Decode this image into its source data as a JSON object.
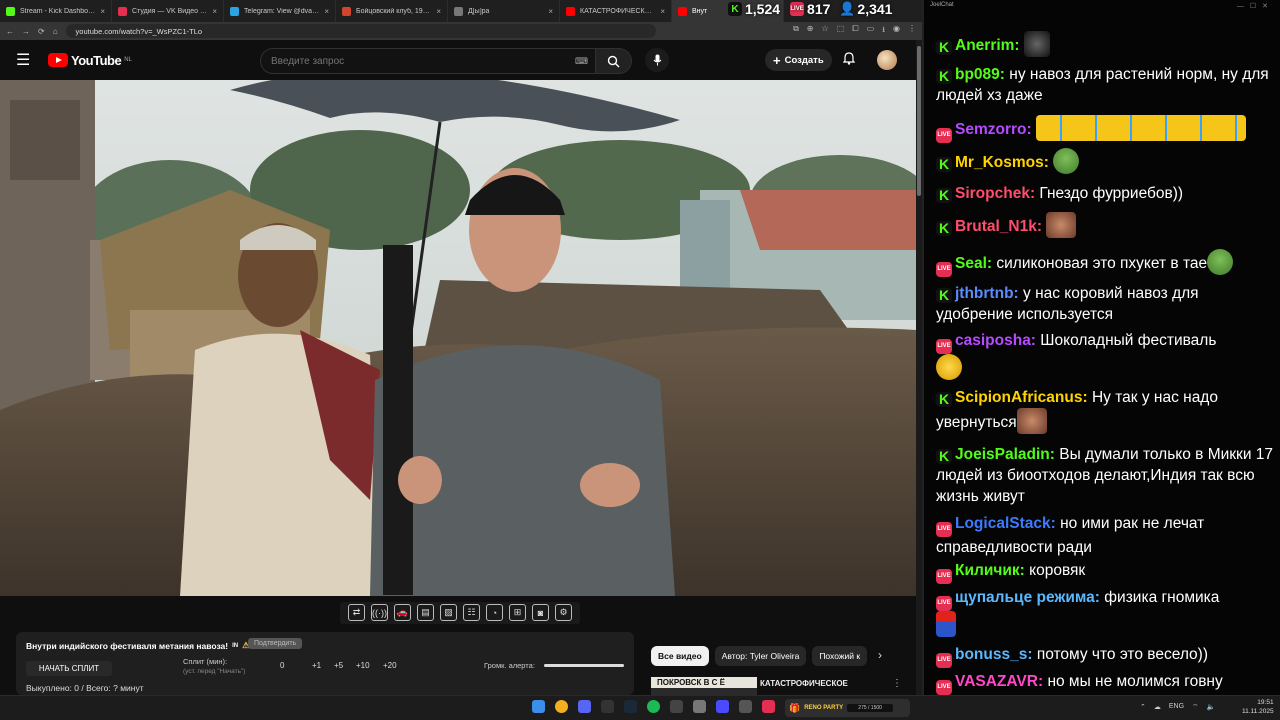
{
  "browser": {
    "tabs": [
      {
        "title": "Stream - Kick Dashboard",
        "color": "#53fc18"
      },
      {
        "title": "Студия — VK Видео Live",
        "color": "#e52f52"
      },
      {
        "title": "Telegram: View @dvachannel",
        "color": "#2aa3e0"
      },
      {
        "title": "Бойцовский клуб, 1999 — см",
        "color": "#d0452b"
      },
      {
        "title": "Д[ы]ра",
        "color": "#777777"
      },
      {
        "title": "КАТАСТРОФИЧЕСКОЕ Пора",
        "color": "#ff0000"
      },
      {
        "title": "Внут",
        "color": "#ff0000"
      }
    ],
    "url": "youtube.com/watch?v=_WsPZC1-TLo"
  },
  "overlay": {
    "kick_viewers": "1,524",
    "vk_viewers": "817",
    "total_viewers": "2,341"
  },
  "youtube": {
    "logo_text": "YouTube",
    "country_code": "NL",
    "search_placeholder": "Введите запрос",
    "create_label": "Создать"
  },
  "alert_panel": {
    "title": "Внутри индийского фестиваля метания навоза!",
    "title_suffix": "IN",
    "confirm_label": "Подтвердить",
    "start_split": "НАЧАТЬ СПЛИТ",
    "split_label": "Сплит (мин):",
    "split_hint": "(уст. перед \"Начать\")",
    "split_value": "0",
    "steps": [
      "+1",
      "+5",
      "+10",
      "+20"
    ],
    "volume_label": "Громк. алерта:",
    "volume_level": 1.0,
    "bought": "Выкуплено: 0 / Всего: ? минут"
  },
  "chips": [
    "Все видео",
    "Автор: Tyler Oliveira",
    "Похожий к"
  ],
  "recommended": {
    "thumb_text": "ПОКРОВСК В С Ё",
    "title": "КАТАСТРОФИЧЕСКОЕ"
  },
  "chat": {
    "app_title": "JoelChat",
    "messages": [
      {
        "platform": "kick",
        "nick": "Anerrim:",
        "color": "#53fc18",
        "text": "",
        "emote": "dark"
      },
      {
        "platform": "kick",
        "nick": "bp089:",
        "color": "#53fc18",
        "text": "ну навоз для растений норм, ну для людей хз даже"
      },
      {
        "platform": "vk",
        "nick": "Semzorro:",
        "color": "#b64bff",
        "text": "",
        "emote": "cry-row"
      },
      {
        "platform": "kick",
        "nick": "Mr_Kosmos:",
        "color": "#ffd400",
        "text": "",
        "emote": "pepe"
      },
      {
        "platform": "kick",
        "nick": "Siropchek:",
        "color": "#ff4d6d",
        "text": "Гнездо фурриебов))"
      },
      {
        "platform": "kick",
        "nick": "Brutal_N1k:",
        "color": "#ff4d6d",
        "text": "",
        "emote": "face"
      },
      {
        "platform": "vk",
        "nick": "Seal:",
        "color": "#53fc18",
        "text": "силиконовая это пхукет в тае",
        "emote": "pepe"
      },
      {
        "platform": "kick",
        "nick": "jthbrtnb:",
        "color": "#5b8cff",
        "text": "у нас коровий навоз для удобрение используется"
      },
      {
        "platform": "vk",
        "nick": "casiposha:",
        "color": "#b64bff",
        "text": "Шоколадный фестиваль",
        "emote": "yellow"
      },
      {
        "platform": "kick",
        "nick": "ScipionAfricanus:",
        "color": "#ffd400",
        "text": "Ну так у нас надо увернуться",
        "emote": "face"
      },
      {
        "platform": "kick",
        "nick": "JoeisPaladin:",
        "color": "#53fc18",
        "text": "Вы думали только в Микки 17 людей из биоотходов делают,Индия так всю жизнь живут"
      },
      {
        "platform": "vk",
        "nick": "LogicalStack:",
        "color": "#3b7bff",
        "text": "но ими рак не лечат справедливости ради"
      },
      {
        "platform": "vk",
        "nick": "Киличик:",
        "color": "#53fc18",
        "text": "коровяк"
      },
      {
        "platform": "vk",
        "nick": "щупальце режима:",
        "color": "#5ab8ff",
        "text": "физика гномика",
        "emote": "mario"
      },
      {
        "platform": "vk",
        "nick": "bonuss_s:",
        "color": "#5ab8ff",
        "text": "потому что это весело))"
      },
      {
        "platform": "vk",
        "nick": "VASAZAVR:",
        "color": "#ff47c8",
        "text": "но мы не молимся говну"
      }
    ]
  },
  "taskbar": {
    "gift_label": "RENO PARTY",
    "gift_progress": "275 / 1500",
    "lang": "ENG",
    "time": "19:51",
    "date": "11.11.2025"
  }
}
